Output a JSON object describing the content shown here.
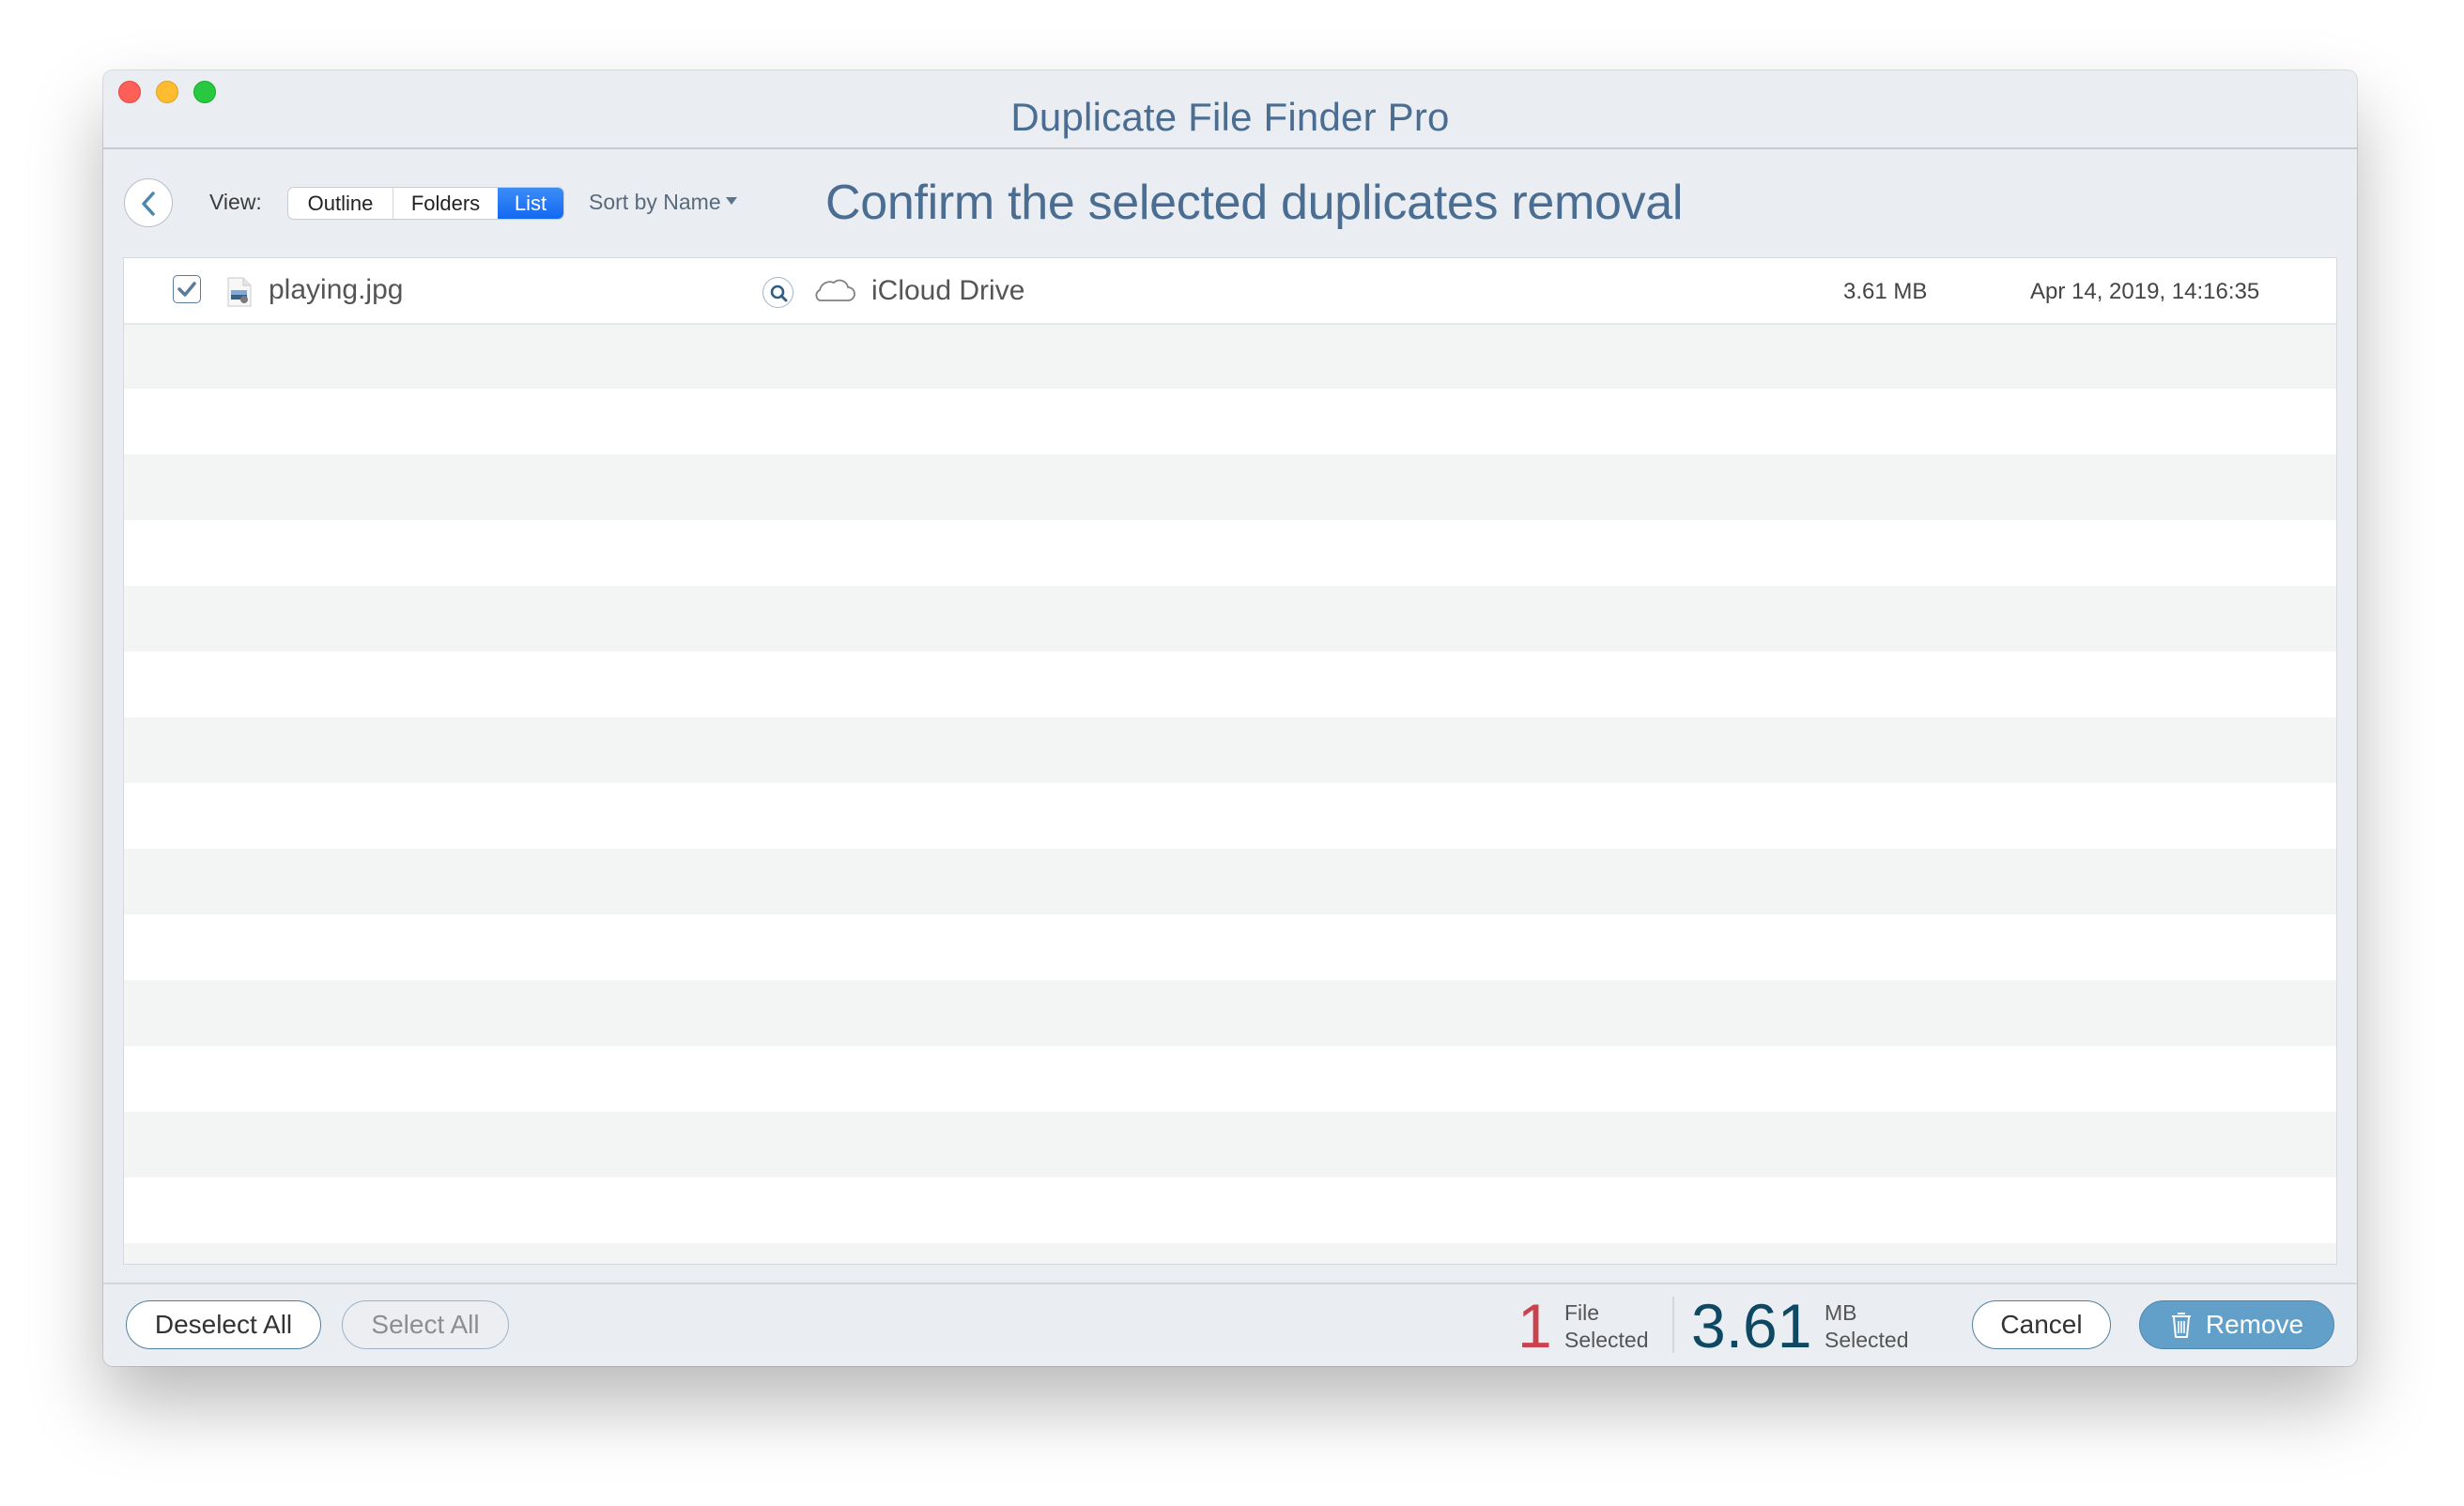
{
  "window": {
    "title": "Duplicate File Finder Pro",
    "traffic_lights": [
      "close",
      "minimize",
      "zoom"
    ]
  },
  "toolbar": {
    "back_icon": "chevron-left-icon",
    "view_label": "View:",
    "view_options": [
      "Outline",
      "Folders",
      "List"
    ],
    "selected_view": "List",
    "sort_label": "Sort by Name",
    "page_title": "Confirm the selected duplicates removal"
  },
  "files": [
    {
      "checked": true,
      "icon": "jpg-file-icon",
      "name": "playing.jpg",
      "reveal_icon": "magnifier-icon",
      "location_icon": "cloud-icon",
      "location": "iCloud Drive",
      "size": "3.61 MB",
      "modified": "Apr 14, 2019, 14:16:35"
    }
  ],
  "footer": {
    "deselect_all": "Deselect All",
    "select_all": "Select All",
    "files_selected_count": "1",
    "files_selected_unit": "File",
    "files_selected_suffix": "Selected",
    "size_selected_value": "3.61",
    "size_selected_unit": "MB",
    "size_selected_suffix": "Selected",
    "cancel": "Cancel",
    "remove": "Remove",
    "remove_icon": "trash-icon"
  },
  "colors": {
    "accent_blue": "#4a6d91",
    "segment_selected": "#1a6ff3",
    "remove_button": "#62a0ca",
    "file_count": "#c9434e",
    "size_count": "#0e4863"
  }
}
